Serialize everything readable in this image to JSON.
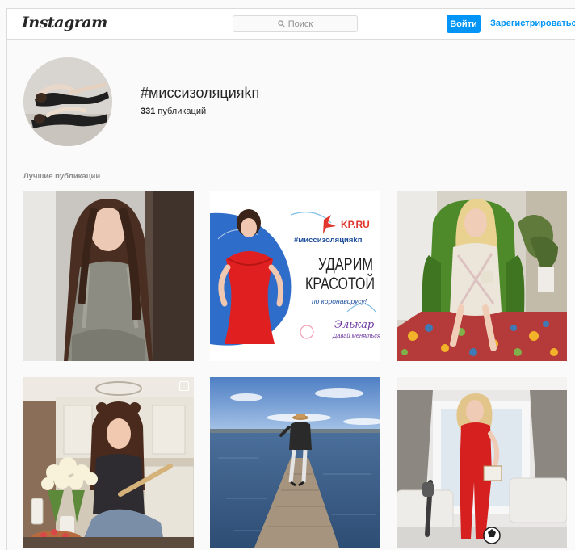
{
  "header": {
    "logo": "Instagram",
    "search_placeholder": "Поиск",
    "login_label": "Войти",
    "signup_label": "Зарегистрироваться"
  },
  "hashtag": {
    "title": "#миссизоляцияkп",
    "posts_count": "331",
    "posts_label": "публикаций"
  },
  "section": {
    "top_posts_label": "Лучшие публикации"
  },
  "posts": [
    {
      "alt": "woman-long-hair-gray-dress"
    },
    {
      "alt": "kp-promo",
      "brand": "KP.RU",
      "hashtag": "#миссизоляцияkп",
      "headline_1": "УДАРИМ",
      "headline_2": "КРАСОТОЙ",
      "subline": "по коронавирусу!",
      "sponsor": "Элькар",
      "sponsor_tagline": "Давай меняться!"
    },
    {
      "alt": "woman-green-armchair"
    },
    {
      "alt": "woman-kitchen-flowers",
      "multi": true
    },
    {
      "alt": "woman-pier-lake"
    },
    {
      "alt": "woman-red-jumpsuit"
    }
  ]
}
